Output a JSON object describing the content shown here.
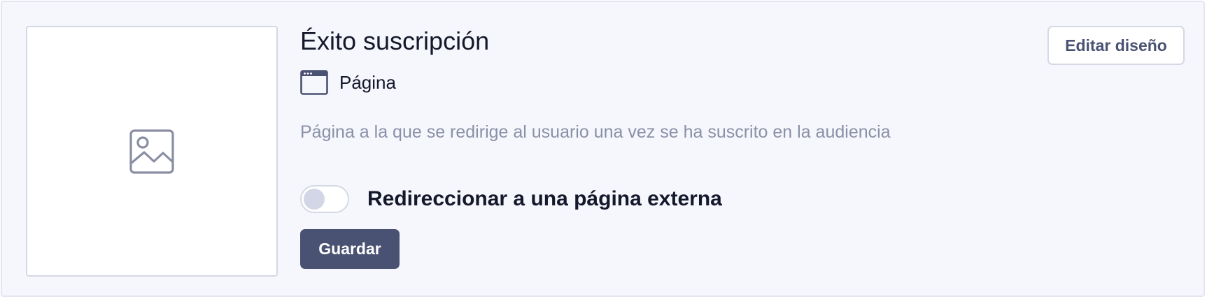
{
  "card": {
    "thumbnail_icon": "image-icon",
    "title": "Éxito suscripción",
    "type": {
      "icon": "browser-window-icon",
      "label": "Página"
    },
    "description": "Página a la que se redirige al usuario una vez se ha suscrito en la audiencia",
    "redirect_toggle": {
      "label": "Redireccionar a una página externa",
      "enabled": false
    },
    "save_label": "Guardar",
    "edit_label": "Editar diseño"
  },
  "colors": {
    "card_background": "#f6f7fc",
    "primary_button": "#4a5273",
    "muted_text": "#8a90a8",
    "title_text": "#14182b"
  }
}
